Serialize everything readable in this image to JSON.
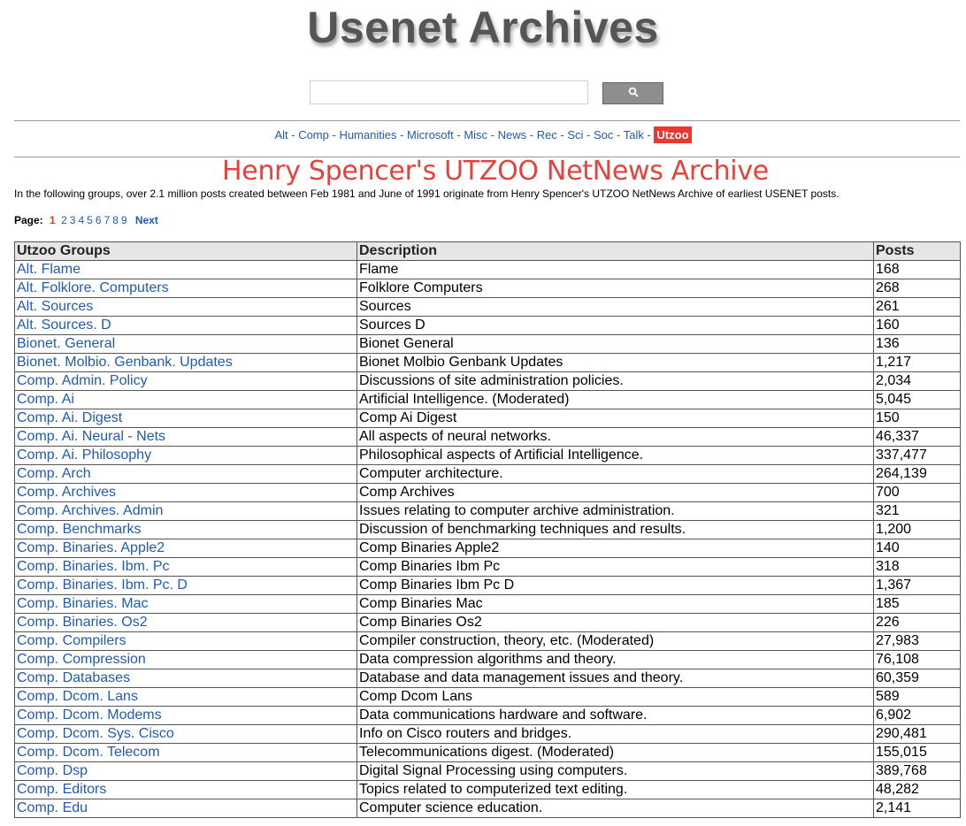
{
  "site": {
    "title": "Usenet Archives"
  },
  "search": {
    "placeholder": "",
    "button_icon": "search-icon"
  },
  "nav": {
    "items": [
      "Alt",
      "Comp",
      "Humanities",
      "Microsoft",
      "Misc",
      "News",
      "Rec",
      "Sci",
      "Soc",
      "Talk"
    ],
    "active": "Utzoo",
    "separator": " - "
  },
  "archive": {
    "heading": "Henry Spencer's UTZOO NetNews Archive",
    "intro": "In the following groups, over 2.1 million posts created between Feb 1981 and June of 1991 originate from Henry Spencer's UTZOO NetNews Archive of earliest USENET posts."
  },
  "pagination": {
    "label": "Page:",
    "current": "1",
    "pages": [
      "2",
      "3",
      "4",
      "5",
      "6",
      "7",
      "8",
      "9"
    ],
    "next": "Next"
  },
  "table": {
    "headers": [
      "Utzoo Groups",
      "Description",
      "Posts"
    ],
    "rows": [
      [
        "Alt. Flame",
        "Flame",
        "168"
      ],
      [
        "Alt. Folklore. Computers",
        "Folklore Computers",
        "268"
      ],
      [
        "Alt. Sources",
        "Sources",
        "261"
      ],
      [
        "Alt. Sources. D",
        "Sources D",
        "160"
      ],
      [
        "Bionet. General",
        "Bionet General",
        "136"
      ],
      [
        "Bionet. Molbio. Genbank. Updates",
        "Bionet Molbio Genbank Updates",
        "1,217"
      ],
      [
        "Comp. Admin. Policy",
        "Discussions of site administration policies.",
        "2,034"
      ],
      [
        "Comp. Ai",
        "Artificial Intelligence. (Moderated)",
        "5,045"
      ],
      [
        "Comp. Ai. Digest",
        "Comp Ai Digest",
        "150"
      ],
      [
        "Comp. Ai. Neural - Nets",
        "All aspects of neural networks.",
        "46,337"
      ],
      [
        "Comp. Ai. Philosophy",
        "Philosophical aspects of Artificial Intelligence.",
        "337,477"
      ],
      [
        "Comp. Arch",
        "Computer architecture.",
        "264,139"
      ],
      [
        "Comp. Archives",
        "Comp Archives",
        "700"
      ],
      [
        "Comp. Archives. Admin",
        "Issues relating to computer archive administration.",
        "321"
      ],
      [
        "Comp. Benchmarks",
        "Discussion of benchmarking techniques and results.",
        "1,200"
      ],
      [
        "Comp. Binaries. Apple2",
        "Comp Binaries Apple2",
        "140"
      ],
      [
        "Comp. Binaries. Ibm. Pc",
        "Comp Binaries Ibm Pc",
        "318"
      ],
      [
        "Comp. Binaries. Ibm. Pc. D",
        "Comp Binaries Ibm Pc D",
        "1,367"
      ],
      [
        "Comp. Binaries. Mac",
        "Comp Binaries Mac",
        "185"
      ],
      [
        "Comp. Binaries. Os2",
        "Comp Binaries Os2",
        "226"
      ],
      [
        "Comp. Compilers",
        "Compiler construction, theory, etc. (Moderated)",
        "27,983"
      ],
      [
        "Comp. Compression",
        "Data compression algorithms and theory.",
        "76,108"
      ],
      [
        "Comp. Databases",
        "Database and data management issues and theory.",
        "60,359"
      ],
      [
        "Comp. Dcom. Lans",
        "Comp Dcom Lans",
        "589"
      ],
      [
        "Comp. Dcom. Modems",
        "Data communications hardware and software.",
        "6,902"
      ],
      [
        "Comp. Dcom. Sys. Cisco",
        "Info on Cisco routers and bridges.",
        "290,481"
      ],
      [
        "Comp. Dcom. Telecom",
        "Telecommunications digest. (Moderated)",
        "155,015"
      ],
      [
        "Comp. Dsp",
        "Digital Signal Processing using computers.",
        "389,768"
      ],
      [
        "Comp. Editors",
        "Topics related to computerized text editing.",
        "48,282"
      ],
      [
        "Comp. Edu",
        "Computer science education.",
        "2,141"
      ]
    ]
  },
  "colors": {
    "link": "#1f5bb5",
    "accent_red": "#e8382f",
    "title_gray": "#555555"
  }
}
